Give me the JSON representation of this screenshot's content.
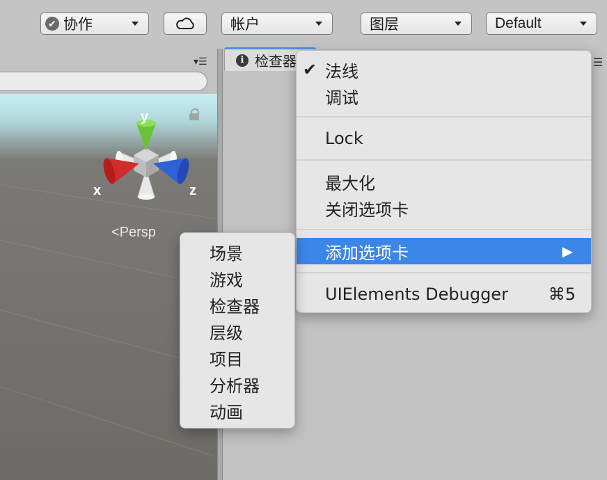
{
  "toolbar": {
    "collab_label": "协作",
    "account_label": "帐户",
    "layers_label": "图层",
    "layout_label": "Default"
  },
  "scene": {
    "gizmo_labels": {
      "y": "y",
      "x": "x",
      "z": "z"
    },
    "persp_label": "Persp"
  },
  "inspector": {
    "tab_label": "检查器"
  },
  "context_menu": {
    "items": [
      {
        "label": "法线",
        "checked": true
      },
      {
        "label": "调试"
      },
      {
        "label": "Lock"
      },
      {
        "label": "最大化"
      },
      {
        "label": "关闭选项卡"
      },
      {
        "label": "添加选项卡",
        "highlighted": true,
        "submenu": true
      },
      {
        "label": "UIElements Debugger",
        "shortcut": "⌘5"
      }
    ]
  },
  "submenu": {
    "items": [
      "场景",
      "游戏",
      "检查器",
      "层级",
      "项目",
      "分析器",
      "动画"
    ]
  },
  "colors": {
    "highlight": "#3b86e6",
    "tab_accent": "#4a90e2",
    "axis_x": "#d32b2b",
    "axis_y": "#6cc236",
    "axis_z": "#2f62d9"
  }
}
